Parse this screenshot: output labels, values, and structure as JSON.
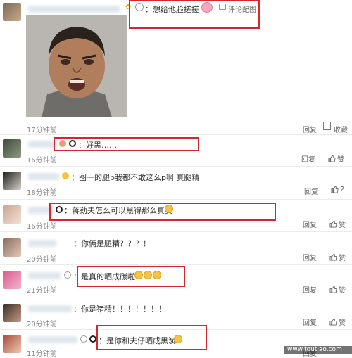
{
  "top_comment": {
    "text": "：想给他脸搓搓",
    "action_label": "评论配图",
    "time": "17分钟前",
    "reply_label": "回复",
    "fav_label": "收藏"
  },
  "comments": [
    {
      "text": "：好黑……",
      "time": "16分钟前",
      "reply_label": "回复",
      "like_label": "赞"
    },
    {
      "text": "：图一的腿p我都不敢这么p啊  真腿精",
      "time": "18分钟前",
      "reply_label": "回复",
      "like_count": "2"
    },
    {
      "text": "：蒋劲夫怎么可以黑得那么真实",
      "time": "16分钟前",
      "reply_label": "回复",
      "like_label": "赞"
    },
    {
      "text": "：你俩是腿精？？？！",
      "time": "20分钟前",
      "reply_label": "回复",
      "like_label": "赞"
    },
    {
      "text": "：是真的晒成碳啦",
      "time": "21分钟前",
      "reply_label": "回复",
      "like_label": "赞"
    },
    {
      "text": "：你是猪精！！！！！！！",
      "time": "20分钟前",
      "reply_label": "回复",
      "like_label": "赞"
    },
    {
      "text": "：是你和夫仔晒成黑炭",
      "time": "11分钟前",
      "reply_label": "回复"
    }
  ],
  "watermark": "www.toutiao.com",
  "colors": {
    "highlight": "#d8242b",
    "meta": "#888888"
  }
}
